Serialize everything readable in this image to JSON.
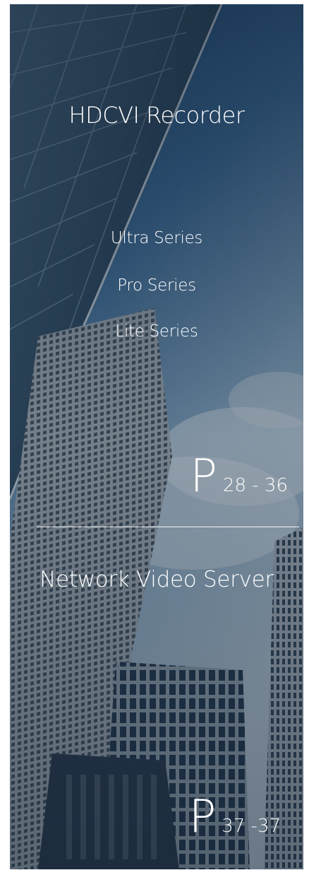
{
  "section1": {
    "title": "HDCVI Recorder",
    "items": [
      "Ultra Series",
      "Pro Series",
      "Lite Series"
    ],
    "page_letter": "P",
    "page_range": "28 - 36"
  },
  "section2": {
    "title": "Network Video Server",
    "page_letter": "P",
    "page_range": "37 -37"
  },
  "colors": {
    "text": "#ffffff",
    "sky_top": "#1f4f86",
    "sky_bottom": "#b9cfe0",
    "overlay": "#1a2c45"
  }
}
